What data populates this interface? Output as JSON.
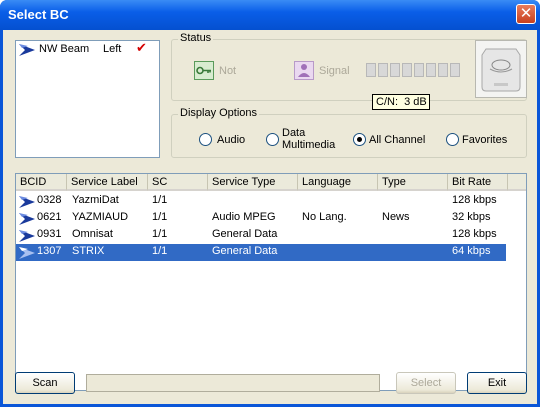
{
  "window": {
    "title": "Select BC",
    "close_glyph": "✕"
  },
  "beam_list": [
    {
      "name": "NW Beam",
      "side": "Left",
      "check_glyph": "✔"
    }
  ],
  "status": {
    "group_label": "Status",
    "key_label": "Not",
    "signal_label": "Signal",
    "signal_level": 0,
    "tooltip": "C/N:  3 dB"
  },
  "display_options": {
    "group_label": "Display Options",
    "options": [
      {
        "label": "Audio",
        "checked": false
      },
      {
        "label": "Data Multimedia",
        "line1": "Data",
        "line2": "Multimedia",
        "checked": false
      },
      {
        "label": "All Channel",
        "checked": true
      },
      {
        "label": "Favorites",
        "checked": false
      }
    ]
  },
  "table": {
    "columns": [
      "BCID",
      "Service Label",
      "SC",
      "Service Type",
      "Language",
      "Type",
      "Bit Rate"
    ],
    "rows": [
      {
        "bcid": "0328",
        "label": "YazmiDat",
        "sc": "1/1",
        "service_type": "",
        "language": "",
        "type": "",
        "bit_rate": "128 kbps",
        "selected": false
      },
      {
        "bcid": "0621",
        "label": "YAZMIAUD",
        "sc": "1/1",
        "service_type": "Audio MPEG",
        "language": "No Lang.",
        "type": "News",
        "bit_rate": "32 kbps",
        "selected": false
      },
      {
        "bcid": "0931",
        "label": "Omnisat",
        "sc": "1/1",
        "service_type": "General Data",
        "language": "",
        "type": "",
        "bit_rate": "128 kbps",
        "selected": false
      },
      {
        "bcid": "1307",
        "label": "STRIX",
        "sc": "1/1",
        "service_type": "General Data",
        "language": "",
        "type": "",
        "bit_rate": "64 kbps",
        "selected": true
      }
    ]
  },
  "buttons": {
    "scan": "Scan",
    "select": "Select",
    "exit": "Exit"
  },
  "progress": 0,
  "colors": {
    "titlebar": "#0a56d8",
    "selection": "#316ac5",
    "check": "#d40000",
    "beam_icon": "#1a3a9c"
  }
}
